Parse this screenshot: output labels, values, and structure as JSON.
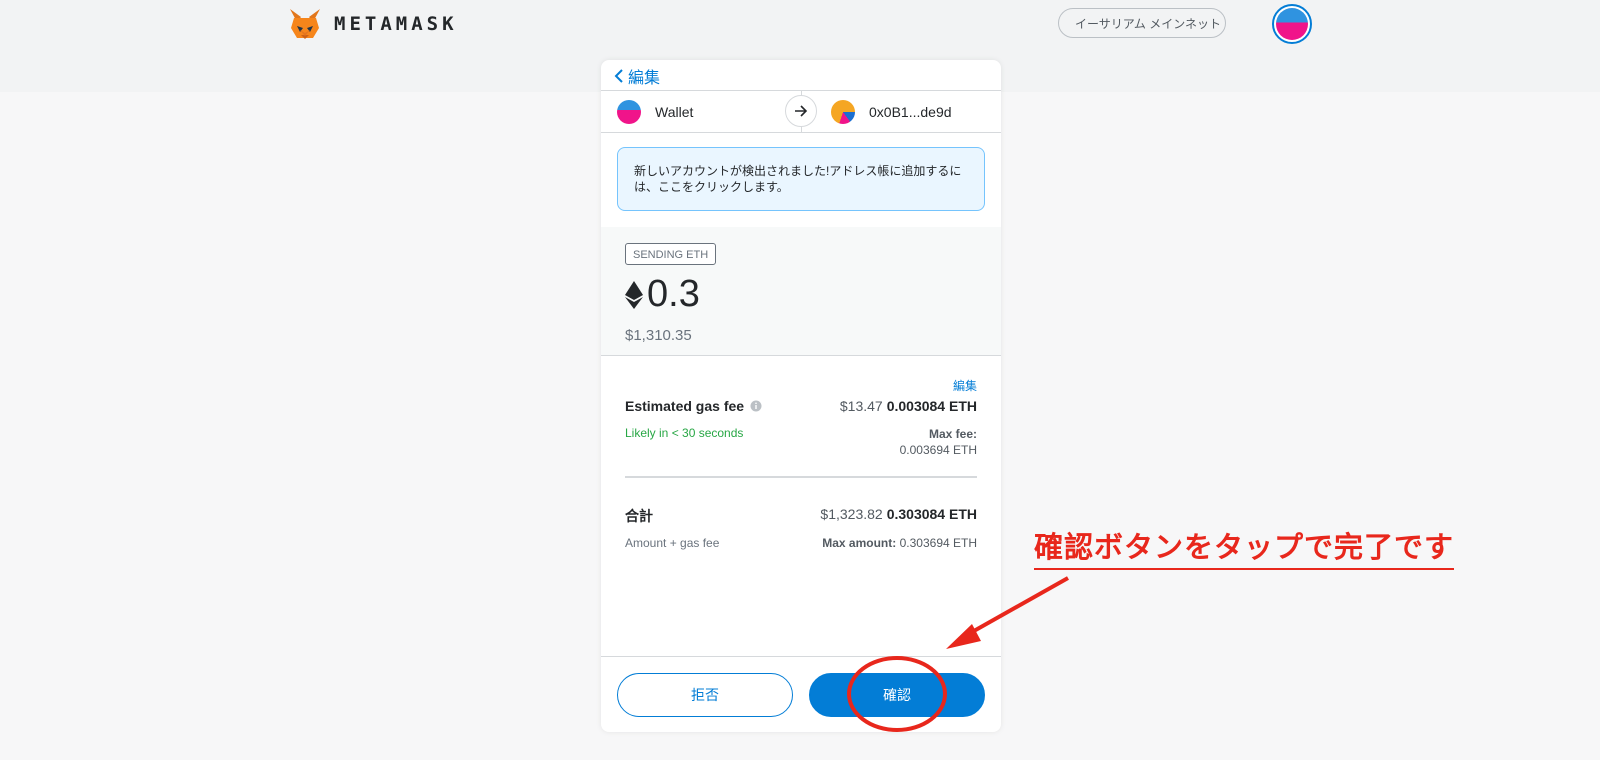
{
  "header": {
    "logo_text": "METAMASK",
    "network_label": "イーサリアム メインネット",
    "network_color": "#29b6af"
  },
  "card": {
    "back_label": "編集",
    "from_name": "Wallet",
    "to_name": "0x0B1...de9d",
    "notice": "新しいアカウントが検出されました!アドレス帳に追加するには、ここをクリックします。",
    "sending_badge": "SENDING ETH",
    "amount": "0.3",
    "fiat_amount": "$1,310.35",
    "edit_link": "編集",
    "gas": {
      "title": "Estimated gas fee",
      "fiat": "$13.47",
      "eth": "0.003084 ETH",
      "likely": "Likely in < 30 seconds",
      "max_fee_label": "Max fee:",
      "max_fee_value": "0.003694 ETH"
    },
    "total": {
      "title": "合計",
      "fiat": "$1,323.82",
      "eth": "0.303084 ETH",
      "subtitle": "Amount + gas fee",
      "max_amount_label": "Max amount:",
      "max_amount_value": "0.303694 ETH"
    },
    "reject_label": "拒否",
    "confirm_label": "確認"
  },
  "annotation": {
    "text": "確認ボタンをタップで完了です",
    "color": "#e8271c"
  },
  "colors": {
    "accent": "#037dd6",
    "success": "#28a745"
  }
}
